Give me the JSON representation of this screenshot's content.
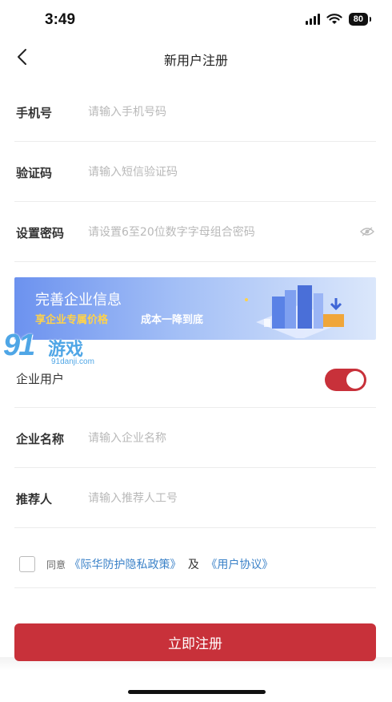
{
  "status_bar": {
    "time": "3:49",
    "battery": "80"
  },
  "nav": {
    "title": "新用户注册"
  },
  "form": {
    "phone": {
      "label": "手机号",
      "placeholder": "请输入手机号码"
    },
    "code": {
      "label": "验证码",
      "placeholder": "请输入短信验证码"
    },
    "password": {
      "label": "设置密码",
      "placeholder": "请设置6至20位数字字母组合密码"
    },
    "enterprise_user": {
      "label": "企业用户",
      "enabled": true
    },
    "company": {
      "label": "企业名称",
      "placeholder": "请输入企业名称"
    },
    "referrer": {
      "label": "推荐人",
      "placeholder": "请输入推荐人工号"
    }
  },
  "banner": {
    "title": "完善企业信息",
    "subtitle_highlight": "享企业专属价格",
    "subtitle_rest": "成本一降到底"
  },
  "watermark": {
    "number": "91",
    "text": "游戏",
    "domain": "91danji.com"
  },
  "agreement": {
    "prefix": "同意",
    "privacy_link": "《际华防护隐私政策》",
    "and": "及",
    "user_link": "《用户协议》"
  },
  "submit_label": "立即注册",
  "colors": {
    "primary": "#c8313a",
    "link": "#3b82c8",
    "banner_highlight": "#ffd24a"
  },
  "icons": {
    "back": "chevron-left-icon",
    "eye": "eye-icon",
    "wifi": "wifi-icon",
    "signal": "signal-icon",
    "battery": "battery-icon"
  }
}
